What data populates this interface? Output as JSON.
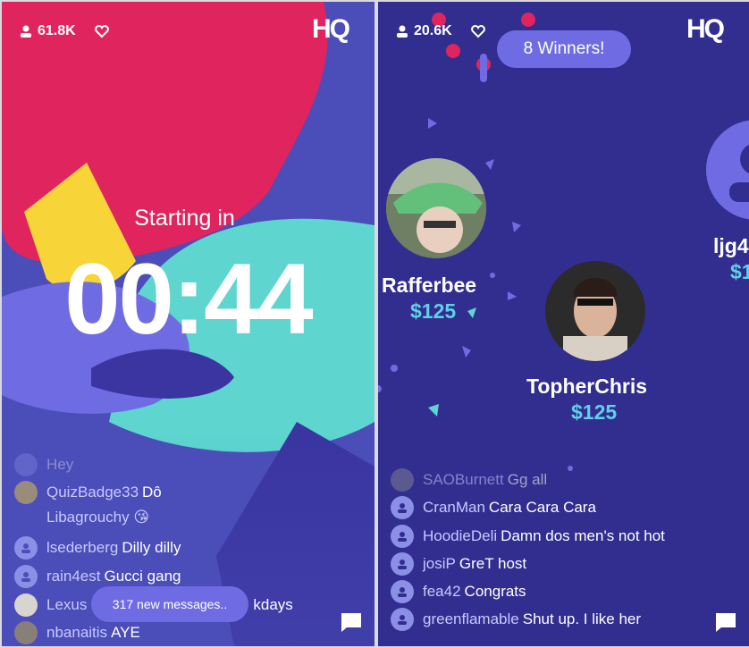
{
  "left": {
    "viewers": "61.8K",
    "logo": "HQ",
    "starting_label": "Starting in",
    "countdown": "00:44",
    "chat": [
      {
        "user": "",
        "msg": "Hey",
        "avatar": "default"
      },
      {
        "user": "QuizBadge33",
        "msg": "Dô",
        "avatar": "photo"
      },
      {
        "user": "",
        "msg": "Libagrouchy 😘",
        "avatar": "none"
      },
      {
        "user": "lsederberg",
        "msg": "Dilly dilly",
        "avatar": "default"
      },
      {
        "user": "rain4est",
        "msg": "Gucci gang",
        "avatar": "default"
      },
      {
        "user": "Lexus",
        "msg": "kdays",
        "avatar": "photo"
      },
      {
        "user": "nbanaitis",
        "msg": "AYE",
        "avatar": "photo"
      }
    ],
    "new_messages": "317 new messages..",
    "colors": {
      "pink": "#e0245e",
      "yellow": "#f7d538",
      "teal": "#5ed6cf",
      "purple": "#4b4db8",
      "dark": "#3a35a0"
    }
  },
  "right": {
    "viewers": "20.6K",
    "logo": "HQ",
    "winners_banner": "8 Winners!",
    "winners": [
      {
        "name": "Rafferbee",
        "prize": "$125"
      },
      {
        "name": "TopherChris",
        "prize": "$125"
      },
      {
        "name": "ljg4",
        "prize": "$1"
      }
    ],
    "chat": [
      {
        "user": "SAOBurnett",
        "msg": "Gg all",
        "avatar": "photo"
      },
      {
        "user": "CranMan",
        "msg": "Cara Cara Cara",
        "avatar": "default"
      },
      {
        "user": "HoodieDeli",
        "msg": "Damn dos men's not hot",
        "avatar": "default"
      },
      {
        "user": "josiP",
        "msg": "GreT host",
        "avatar": "default"
      },
      {
        "user": "fea42",
        "msg": "Congrats",
        "avatar": "default"
      },
      {
        "user": "greenflamable",
        "msg": "Shut up. I like her",
        "avatar": "default"
      }
    ],
    "colors": {
      "bg": "#312e8f",
      "prize": "#5fd0e6",
      "banner": "#6f6ce3"
    }
  }
}
